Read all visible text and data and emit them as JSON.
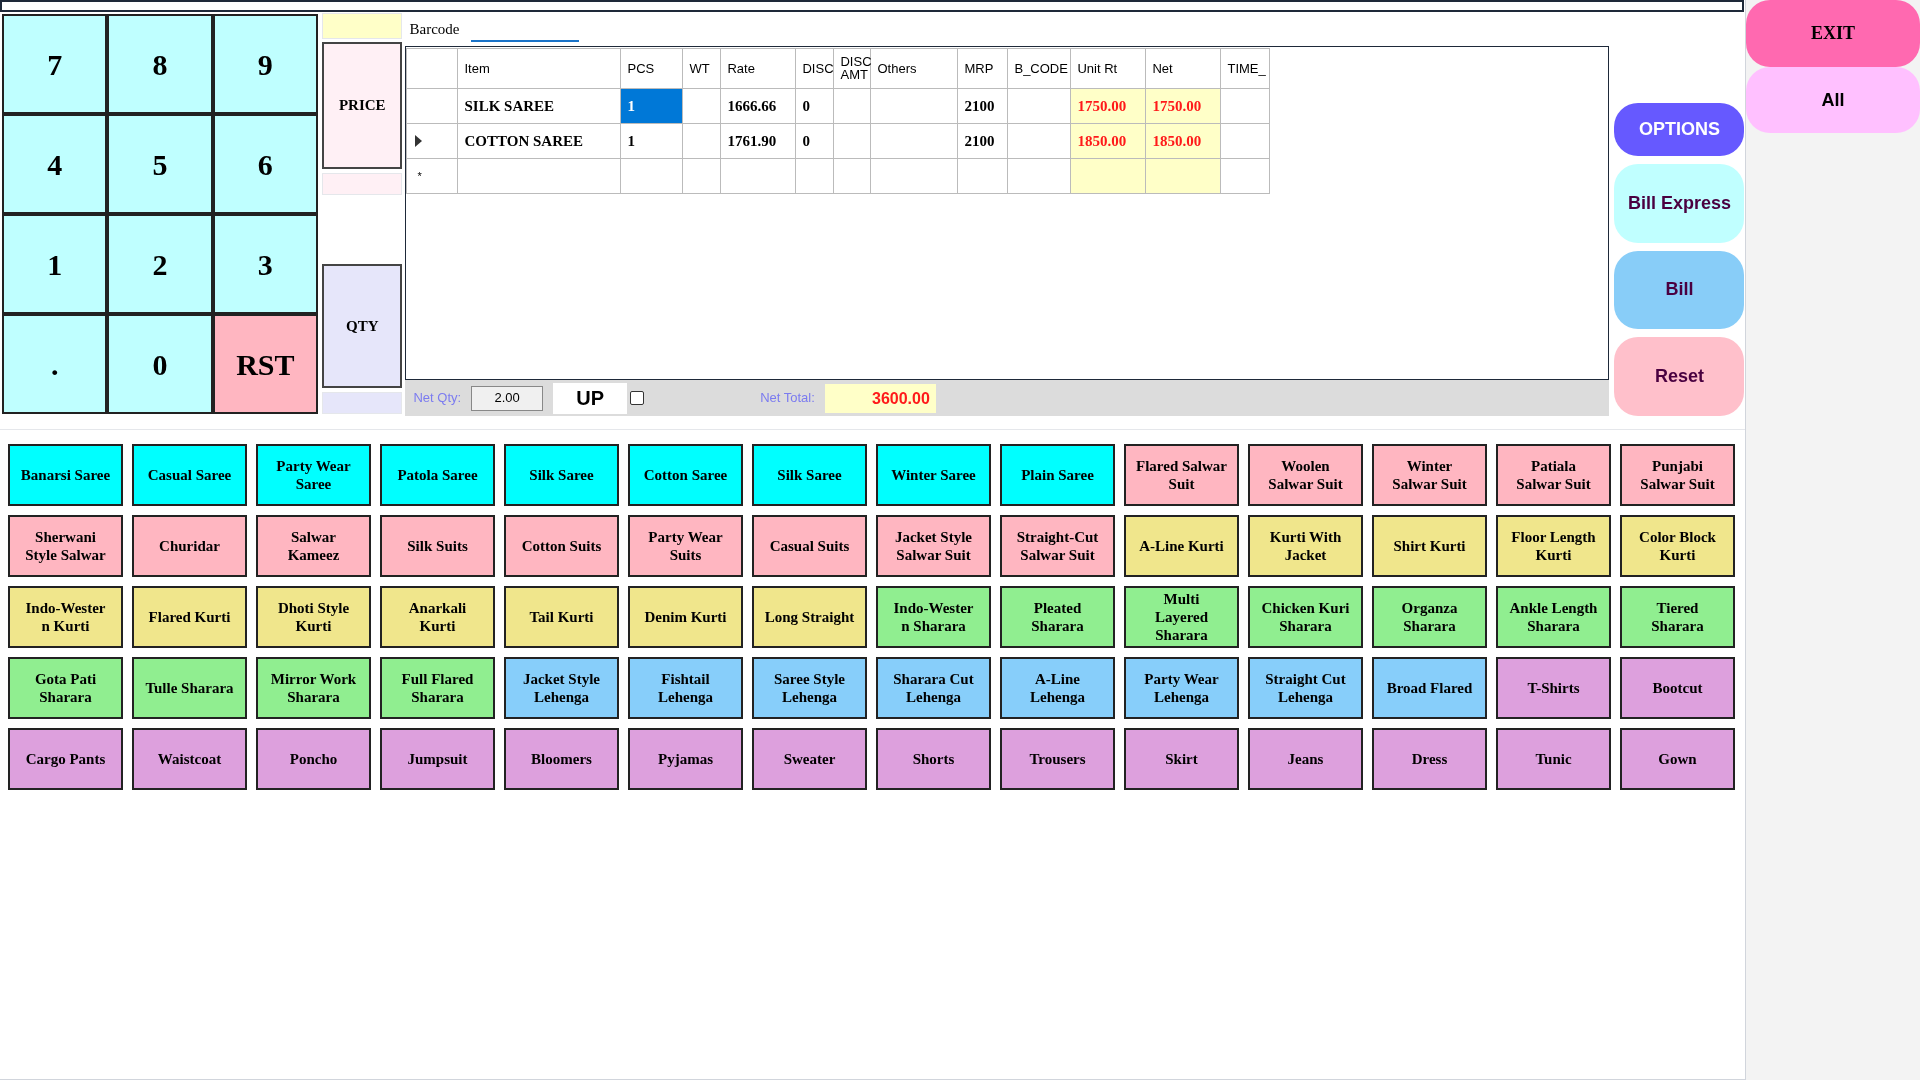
{
  "keypad": [
    {
      "label": "7",
      "kind": "digit"
    },
    {
      "label": "8",
      "kind": "digit"
    },
    {
      "label": "9",
      "kind": "digit"
    },
    {
      "label": "4",
      "kind": "digit"
    },
    {
      "label": "5",
      "kind": "digit"
    },
    {
      "label": "6",
      "kind": "digit"
    },
    {
      "label": "1",
      "kind": "digit"
    },
    {
      "label": "2",
      "kind": "digit"
    },
    {
      "label": "3",
      "kind": "digit"
    },
    {
      "label": ".",
      "kind": "digit"
    },
    {
      "label": "0",
      "kind": "digit"
    },
    {
      "label": "RST",
      "kind": "reset"
    }
  ],
  "mode_buttons": [
    {
      "label": "PRICE",
      "kind": "price"
    },
    {
      "label": "QTY",
      "kind": "qty"
    }
  ],
  "barcode": {
    "label": "Barcode"
  },
  "table": {
    "columns": [
      {
        "label": "Item",
        "kind": "text"
      },
      {
        "label": "PCS",
        "kind": "text"
      },
      {
        "label": "WT",
        "kind": "text"
      },
      {
        "label": "Rate",
        "kind": "text"
      },
      {
        "label": "DISC",
        "kind": "text"
      },
      {
        "label": "DISC AMT",
        "kind": "text"
      },
      {
        "label": "Others",
        "kind": "text"
      },
      {
        "label": "MRP",
        "kind": "text"
      },
      {
        "label": "B_CODE",
        "kind": "text"
      },
      {
        "label": "Unit Rt",
        "kind": "amount"
      },
      {
        "label": "Net",
        "kind": "amount"
      },
      {
        "label": "TIME_",
        "kind": "text"
      }
    ],
    "rows": [
      {
        "current": false,
        "cells": [
          {
            "text": "SILK SAREE",
            "selected": false
          },
          {
            "text": "1",
            "selected": true
          },
          {
            "selected": false
          },
          {
            "text": "1666.66",
            "selected": false
          },
          {
            "text": "0",
            "selected": false
          },
          {
            "selected": false
          },
          {
            "selected": false
          },
          {
            "text": "2100",
            "selected": false
          },
          {
            "selected": false
          },
          {
            "text": "1750.00",
            "selected": false
          },
          {
            "text": "1750.00",
            "selected": false
          },
          {
            "selected": false
          }
        ]
      },
      {
        "current": true,
        "cells": [
          {
            "text": "COTTON SAREE",
            "selected": false
          },
          {
            "text": "1",
            "selected": false
          },
          {
            "selected": false
          },
          {
            "text": "1761.90",
            "selected": false
          },
          {
            "text": "0",
            "selected": false
          },
          {
            "selected": false
          },
          {
            "selected": false
          },
          {
            "text": "2100",
            "selected": false
          },
          {
            "selected": false
          },
          {
            "text": "1850.00",
            "selected": false
          },
          {
            "text": "1850.00",
            "selected": false
          },
          {
            "selected": false
          }
        ]
      }
    ],
    "new_row": {
      "marker": "*"
    }
  },
  "footer": {
    "net_qty_label": "Net Qty:",
    "net_qty": "2.00",
    "up_button": "UP",
    "checkbox_checked": false,
    "net_total_label": "Net Total:",
    "net_total": "3600.00"
  },
  "actions": [
    {
      "label": "OPTIONS",
      "kind": "options"
    },
    {
      "label": "Bill Express",
      "kind": "bill_express"
    },
    {
      "label": "Bill",
      "kind": "bill"
    },
    {
      "label": "Reset",
      "kind": "reset"
    }
  ],
  "side_panel": [
    {
      "label": "EXIT",
      "kind": "exit"
    },
    {
      "label": "All",
      "kind": "all"
    }
  ],
  "categories": [
    {
      "label": "Banarsi Saree",
      "color": "#00ffff"
    },
    {
      "label": "Casual Saree",
      "color": "#00ffff"
    },
    {
      "label": "Party Wear Saree",
      "color": "#00ffff"
    },
    {
      "label": "Patola Saree",
      "color": "#00ffff"
    },
    {
      "label": "Silk Saree",
      "color": "#00ffff"
    },
    {
      "label": "Cotton Saree",
      "color": "#00ffff"
    },
    {
      "label": "Silk Saree",
      "color": "#00ffff"
    },
    {
      "label": "Winter Saree",
      "color": "#00ffff"
    },
    {
      "label": "Plain Saree",
      "color": "#00ffff"
    },
    {
      "label": "Flared Salwar Suit",
      "color": "#ffb6c1"
    },
    {
      "label": "Woolen Salwar Suit",
      "color": "#ffb6c1"
    },
    {
      "label": "Winter Salwar Suit",
      "color": "#ffb6c1"
    },
    {
      "label": "Patiala Salwar Suit",
      "color": "#ffb6c1"
    },
    {
      "label": "Punjabi Salwar Suit",
      "color": "#ffb6c1"
    },
    {
      "label": "Sherwani Style Salwar",
      "color": "#ffb6c1"
    },
    {
      "label": "Churidar",
      "color": "#ffb6c1"
    },
    {
      "label": "Salwar Kameez",
      "color": "#ffb6c1"
    },
    {
      "label": "Silk Suits",
      "color": "#ffb6c1"
    },
    {
      "label": "Cotton Suits",
      "color": "#ffb6c1"
    },
    {
      "label": "Party Wear Suits",
      "color": "#ffb6c1"
    },
    {
      "label": "Casual Suits",
      "color": "#ffb6c1"
    },
    {
      "label": "Jacket Style Salwar Suit",
      "color": "#ffb6c1"
    },
    {
      "label": "Straight-Cut Salwar Suit",
      "color": "#ffb6c1"
    },
    {
      "label": "A-Line Kurti",
      "color": "#f0e68c"
    },
    {
      "label": "Kurti With Jacket",
      "color": "#f0e68c"
    },
    {
      "label": "Shirt Kurti",
      "color": "#f0e68c"
    },
    {
      "label": "Floor Length Kurti",
      "color": "#f0e68c"
    },
    {
      "label": "Color Block Kurti",
      "color": "#f0e68c"
    },
    {
      "label": "Indo-Wester\nn Kurti",
      "color": "#f0e68c"
    },
    {
      "label": "Flared Kurti",
      "color": "#f0e68c"
    },
    {
      "label": "Dhoti Style Kurti",
      "color": "#f0e68c"
    },
    {
      "label": "Anarkali Kurti",
      "color": "#f0e68c"
    },
    {
      "label": "Tail Kurti",
      "color": "#f0e68c"
    },
    {
      "label": "Denim Kurti",
      "color": "#f0e68c"
    },
    {
      "label": "Long Straight",
      "color": "#f0e68c"
    },
    {
      "label": "Indo-Wester\nn Sharara",
      "color": "#90ee90"
    },
    {
      "label": "Pleated Sharara",
      "color": "#90ee90"
    },
    {
      "label": "Multi Layered Sharara",
      "color": "#90ee90"
    },
    {
      "label": "Chicken Kuri Sharara",
      "color": "#90ee90"
    },
    {
      "label": "Organza Sharara",
      "color": "#90ee90"
    },
    {
      "label": "Ankle Length Sharara",
      "color": "#90ee90"
    },
    {
      "label": "Tiered Sharara",
      "color": "#90ee90"
    },
    {
      "label": "Gota Pati Sharara",
      "color": "#90ee90"
    },
    {
      "label": "Tulle Sharara",
      "color": "#90ee90"
    },
    {
      "label": "Mirror Work Sharara",
      "color": "#90ee90"
    },
    {
      "label": "Full Flared Sharara",
      "color": "#90ee90"
    },
    {
      "label": "Jacket Style Lehenga",
      "color": "#87cefa"
    },
    {
      "label": "Fishtail Lehenga",
      "color": "#87cefa"
    },
    {
      "label": "Saree Style Lehenga",
      "color": "#87cefa"
    },
    {
      "label": "Sharara Cut Lehenga",
      "color": "#87cefa"
    },
    {
      "label": "A-Line Lehenga",
      "color": "#87cefa"
    },
    {
      "label": "Party Wear Lehenga",
      "color": "#87cefa"
    },
    {
      "label": "Straight Cut Lehenga",
      "color": "#87cefa"
    },
    {
      "label": "Broad Flared",
      "color": "#87cefa"
    },
    {
      "label": "T-Shirts",
      "color": "#dda0dd"
    },
    {
      "label": "Bootcut",
      "color": "#dda0dd"
    },
    {
      "label": "Cargo Pants",
      "color": "#dda0dd"
    },
    {
      "label": "Waistcoat",
      "color": "#dda0dd"
    },
    {
      "label": "Poncho",
      "color": "#dda0dd"
    },
    {
      "label": "Jumpsuit",
      "color": "#dda0dd"
    },
    {
      "label": "Bloomers",
      "color": "#dda0dd"
    },
    {
      "label": "Pyjamas",
      "color": "#dda0dd"
    },
    {
      "label": "Sweater",
      "color": "#dda0dd"
    },
    {
      "label": "Shorts",
      "color": "#dda0dd"
    },
    {
      "label": "Trousers",
      "color": "#dda0dd"
    },
    {
      "label": "Skirt",
      "color": "#dda0dd"
    },
    {
      "label": "Jeans",
      "color": "#dda0dd"
    },
    {
      "label": "Dress",
      "color": "#dda0dd"
    },
    {
      "label": "Tunic",
      "color": "#dda0dd"
    },
    {
      "label": "Gown",
      "color": "#dda0dd"
    }
  ]
}
